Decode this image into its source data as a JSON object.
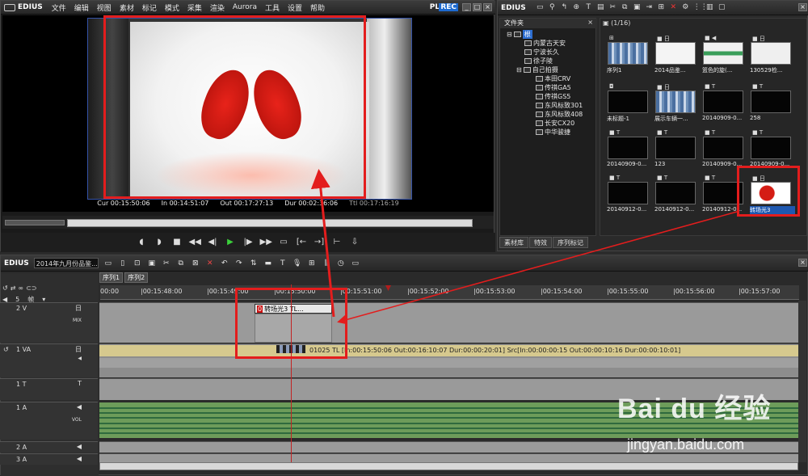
{
  "player": {
    "app_name": "EDIUS",
    "menu": [
      "文件",
      "编辑",
      "视图",
      "素材",
      "标记",
      "模式",
      "采集",
      "渲染",
      "Aurora",
      "工具",
      "设置",
      "帮助"
    ],
    "plr_label": "PLR",
    "rec_label": "REC",
    "timecodes": {
      "cur": "Cur 00:15:50:06",
      "in": "In 00:14:51:07",
      "out": "Out 00:17:27:13",
      "dur": "Dur 00:02:36:06",
      "ttl": "Ttl 00:17:16:19"
    },
    "transport_icons": [
      "mark-in-icon",
      "mark-out-icon",
      "stop-icon",
      "rewind-icon",
      "step-back-icon",
      "play-icon",
      "step-forward-icon",
      "fast-forward-icon",
      "loop-icon",
      "insert-icon",
      "overwrite-icon",
      "split-icon",
      "export-icon"
    ]
  },
  "bin": {
    "title": "EDIUS",
    "folder_pane_title": "文件夹",
    "folder_path": "▣ (1/16)",
    "tree": [
      {
        "label": "根",
        "level": 0
      },
      {
        "label": "内蒙古天安",
        "level": 1
      },
      {
        "label": "宁波长久",
        "level": 1
      },
      {
        "label": "徐子陵",
        "level": 1
      },
      {
        "label": "自己拍摄",
        "level": 1
      },
      {
        "label": "本田CRV",
        "level": 2
      },
      {
        "label": "传祺GA5",
        "level": 2
      },
      {
        "label": "传祺GS5",
        "level": 2
      },
      {
        "label": "东风标致301",
        "level": 2
      },
      {
        "label": "东风标致408",
        "level": 2
      },
      {
        "label": "长安CX20",
        "level": 2
      },
      {
        "label": "中华骏捷",
        "level": 2
      }
    ],
    "clips": [
      {
        "name": "序列1",
        "kind": "mosaic",
        "indicator": "⊞"
      },
      {
        "name": "2014品鉴...",
        "kind": "white",
        "indicator": "■ 日"
      },
      {
        "name": "篮色的旋(...",
        "kind": "green",
        "indicator": "■ ◀"
      },
      {
        "name": "130529检...",
        "kind": "gradient",
        "indicator": "■ 日"
      },
      {
        "name": "未标题-1",
        "kind": "black",
        "indicator": "◘"
      },
      {
        "name": "展示车辆一...",
        "kind": "mosaic",
        "indicator": "■ 日"
      },
      {
        "name": "20140909-0...",
        "kind": "black",
        "indicator": "■ T"
      },
      {
        "name": "258",
        "kind": "black",
        "indicator": "■ T"
      },
      {
        "name": "20140909-0...",
        "kind": "black",
        "indicator": "■ T"
      },
      {
        "name": "123",
        "kind": "black",
        "indicator": "■ T"
      },
      {
        "name": "20140909-0...",
        "kind": "black",
        "indicator": "■ T"
      },
      {
        "name": "20140909-0...",
        "kind": "black",
        "indicator": "■ T"
      },
      {
        "name": "20140912-0...",
        "kind": "black",
        "indicator": "■ T"
      },
      {
        "name": "20140912-0...",
        "kind": "black",
        "indicator": "■ T"
      },
      {
        "name": "20140912-0...",
        "kind": "black",
        "indicator": "■ T"
      },
      {
        "name": "转场光3",
        "kind": "redwhite",
        "indicator": "■ 日"
      }
    ],
    "tabs": [
      "素材库",
      "特效",
      "序列标记"
    ]
  },
  "timeline": {
    "app_name": "EDIUS",
    "project_name": "2014年九月份品鉴...",
    "sequence_tabs": [
      "序列1",
      "序列2"
    ],
    "header_count": "5",
    "header_unit": "帧",
    "ruler_ticks": [
      "00:00",
      "|00:15:48:00",
      "|00:15:49:00",
      "|00:15:50:00",
      "|00:15:51:00",
      "|00:15:52:00",
      "|00:15:53:00",
      "|00:15:54:00",
      "|00:15:55:00",
      "|00:15:56:00",
      "|00:15:57:00"
    ],
    "tracks": [
      {
        "name": "2 V",
        "icon": "日",
        "extra": "MIX"
      },
      {
        "name": "1 VA",
        "icon": "日",
        "extra": "◀"
      },
      {
        "name": "1 T",
        "icon": "T",
        "extra": ""
      },
      {
        "name": "1 A",
        "icon": "◀",
        "extra": "VOL"
      },
      {
        "name": "2 A",
        "icon": "◀",
        "extra": ""
      },
      {
        "name": "3 A",
        "icon": "◀",
        "extra": ""
      }
    ],
    "clip_2v_label": "转场光3  TL...",
    "clip_1va_info": "01025  TL [In:00:15:50:06 Out:00:16:10:07 Dur:00:00:20:01]  Src[In:00:00:00:15 Out:00:00:10:16 Dur:00:00:10:01]"
  },
  "watermark": {
    "logo": "Bai du 经验",
    "url": "jingyan.baidu.com"
  }
}
